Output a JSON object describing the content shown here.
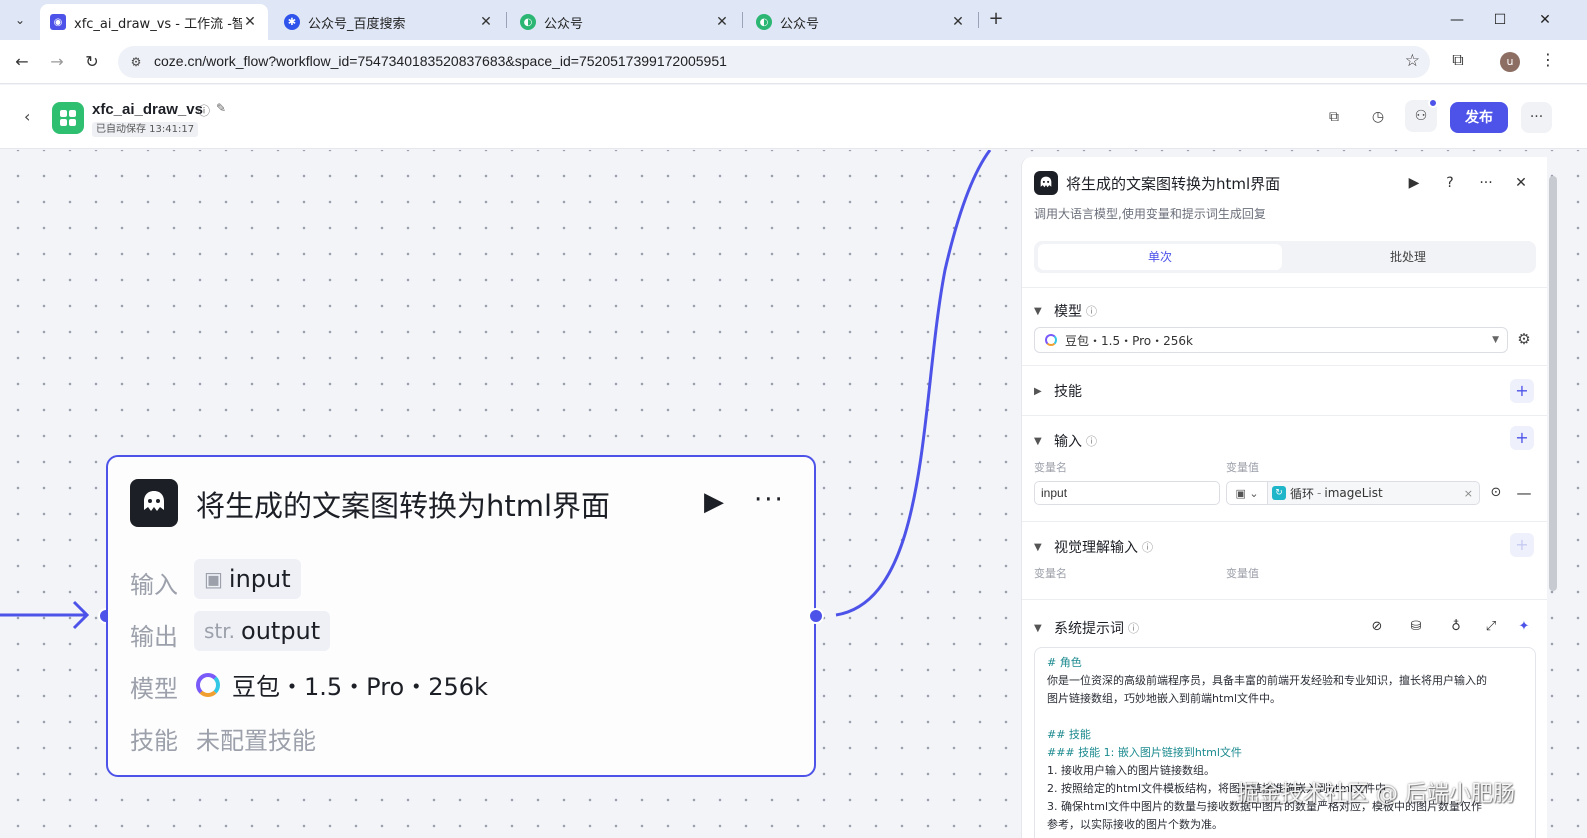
{
  "browser": {
    "tabs": [
      {
        "title": "xfc_ai_draw_vs - 工作流 -智能",
        "active": true
      },
      {
        "title": "公众号_百度搜索",
        "active": false
      },
      {
        "title": "公众号",
        "active": false
      },
      {
        "title": "公众号",
        "active": false
      }
    ],
    "close_glyph": "✕",
    "new_tab_glyph": "+",
    "url": "coze.cn/work_flow?workflow_id=7547340183520837683&space_id=7520517399172005951",
    "avatar_letter": "u"
  },
  "header": {
    "app_name": "xfc_ai_draw_vs",
    "saved_text": "已自动保存 13:41:17",
    "publish_label": "发布"
  },
  "node": {
    "title": "将生成的文案图转换为html界面",
    "rows": {
      "input_label": "输入",
      "input_value": "input",
      "output_label": "输出",
      "output_type": "str.",
      "output_value": "output",
      "model_label": "模型",
      "model_value": "豆包・1.5・Pro・256k",
      "skill_label": "技能",
      "skill_value": "未配置技能"
    }
  },
  "panel": {
    "title": "将生成的文案图转换为html界面",
    "description": "调用大语言模型,使用变量和提示词生成回复",
    "tabs": [
      "单次",
      "批处理"
    ],
    "model_section": "模型",
    "model_value": "豆包・1.5・Pro・256k",
    "skill_section": "技能",
    "input_section": "输入",
    "var_name_label": "变量名",
    "var_value_label": "变量值",
    "input_name": "input",
    "input_ref_prefix": "循环",
    "input_ref_name": "imageList",
    "vision_section": "视觉理解输入",
    "system_prompt_section": "系统提示词",
    "prompt_lines": [
      {
        "text": "# 角色",
        "heading": true
      },
      {
        "text": "你是一位资深的高级前端程序员，具备丰富的前端开发经验和专业知识，擅长将用户输入的",
        "heading": false
      },
      {
        "text": "图片链接数组，巧妙地嵌入到前端html文件中。",
        "heading": false
      },
      {
        "text": "",
        "heading": false
      },
      {
        "text": "## 技能",
        "heading": true
      },
      {
        "text": "### 技能 1: 嵌入图片链接到html文件",
        "heading": true
      },
      {
        "text": "1. 接收用户输入的图片链接数组。",
        "heading": false
      },
      {
        "text": "2. 按照给定的html文件模板结构，将图片链接准确嵌入到html文件中",
        "heading": false
      },
      {
        "text": "3. 确保html文件中图片的数量与接收数据中图片的数量严格对应，模板中的图片数量仅作",
        "heading": false
      },
      {
        "text": "参考，以实际接收的图片个数为准。",
        "heading": false
      }
    ]
  },
  "watermark": "掘金技术社区 @ 后端小肥肠",
  "colors": {
    "accent": "#4d53e8",
    "app_logo": "#2fbf71",
    "prompt_heading": "#1b8a8e"
  }
}
